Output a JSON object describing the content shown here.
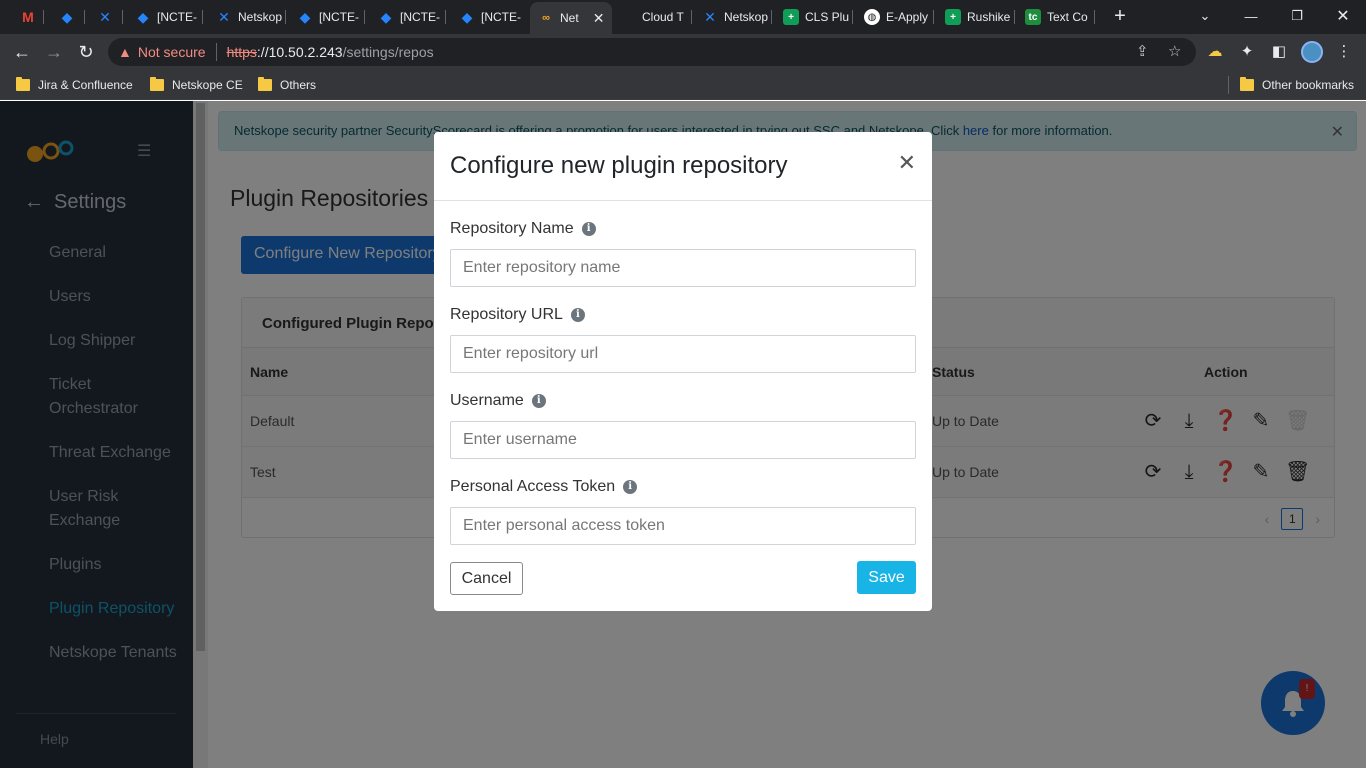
{
  "browser": {
    "tabs": [
      {
        "label": "",
        "icon": "gmail-icon",
        "color": "#ea4335"
      },
      {
        "label": "",
        "icon": "jira-icon",
        "color": "#2684ff"
      },
      {
        "label": "",
        "icon": "confluence-icon",
        "color": "#2684ff"
      },
      {
        "label": "[NCTE-",
        "icon": "jira-icon",
        "color": "#2684ff"
      },
      {
        "label": "Netskop",
        "icon": "confluence-icon",
        "color": "#2684ff"
      },
      {
        "label": "[NCTE-",
        "icon": "jira-icon",
        "color": "#2684ff"
      },
      {
        "label": "[NCTE-",
        "icon": "jira-icon",
        "color": "#2684ff"
      },
      {
        "label": "[NCTE-",
        "icon": "jira-icon",
        "color": "#2684ff"
      },
      {
        "label": "Net",
        "icon": "netskope-icon",
        "color": "#f5a623",
        "active": true
      },
      {
        "label": "Cloud T",
        "icon": "",
        "color": "#202124"
      },
      {
        "label": "Netskop",
        "icon": "confluence-icon",
        "color": "#2684ff"
      },
      {
        "label": "CLS Plu",
        "icon": "sheets-icon",
        "color": "#0f9d58"
      },
      {
        "label": "E-Apply",
        "icon": "globe-icon",
        "color": "#ffffff"
      },
      {
        "label": "Rushike",
        "icon": "sheets-icon",
        "color": "#0f9d58"
      },
      {
        "label": "Text Co",
        "icon": "textcompare-icon",
        "color": "#1e8e3e"
      }
    ],
    "omnibox": {
      "security": "Not secure",
      "scheme": "https",
      "host": "://10.50.2.243",
      "path": "/settings/repos"
    },
    "bookmarks": [
      "Jira & Confluence",
      "Netskope CE",
      "Others"
    ],
    "other_bookmarks": "Other bookmarks"
  },
  "sidebar": {
    "back_label": "Settings",
    "items": [
      {
        "label": "General"
      },
      {
        "label": "Users"
      },
      {
        "label": "Log Shipper"
      },
      {
        "label": "Ticket Orchestrator"
      },
      {
        "label": "Threat Exchange"
      },
      {
        "label": "User Risk Exchange"
      },
      {
        "label": "Plugins"
      },
      {
        "label": "Plugin Repository",
        "active": true
      },
      {
        "label": "Netskope Tenants"
      }
    ],
    "help": "Help"
  },
  "main": {
    "promo_before": "Netskope security partner SecurityScorecard is offering a promotion for users interested in trying out SSC and Netskope. Click ",
    "promo_link": "here",
    "promo_after": " for more information.",
    "title": "Plugin Repositories",
    "configure_button": "Configure New Repository",
    "card_title": "Configured Plugin Repositories",
    "columns": {
      "name": "Name",
      "status": "Status",
      "action": "Action"
    },
    "rows": [
      {
        "name": "Default",
        "status": "Up to Date"
      },
      {
        "name": "Test",
        "status": "Up to Date"
      }
    ],
    "page": "1",
    "notification_badge": "!"
  },
  "modal": {
    "title": "Configure new plugin repository",
    "fields": [
      {
        "label": "Repository Name",
        "placeholder": "Enter repository name"
      },
      {
        "label": "Repository URL",
        "placeholder": "Enter repository url"
      },
      {
        "label": "Username",
        "placeholder": "Enter username"
      },
      {
        "label": "Personal Access Token",
        "placeholder": "Enter personal access token"
      }
    ],
    "cancel": "Cancel",
    "save": "Save"
  },
  "colors": {
    "accent": "#1a73d9",
    "save": "#17b4e5",
    "sidebar_bg": "#25303a",
    "sidebar_active": "#1ba4d0"
  }
}
